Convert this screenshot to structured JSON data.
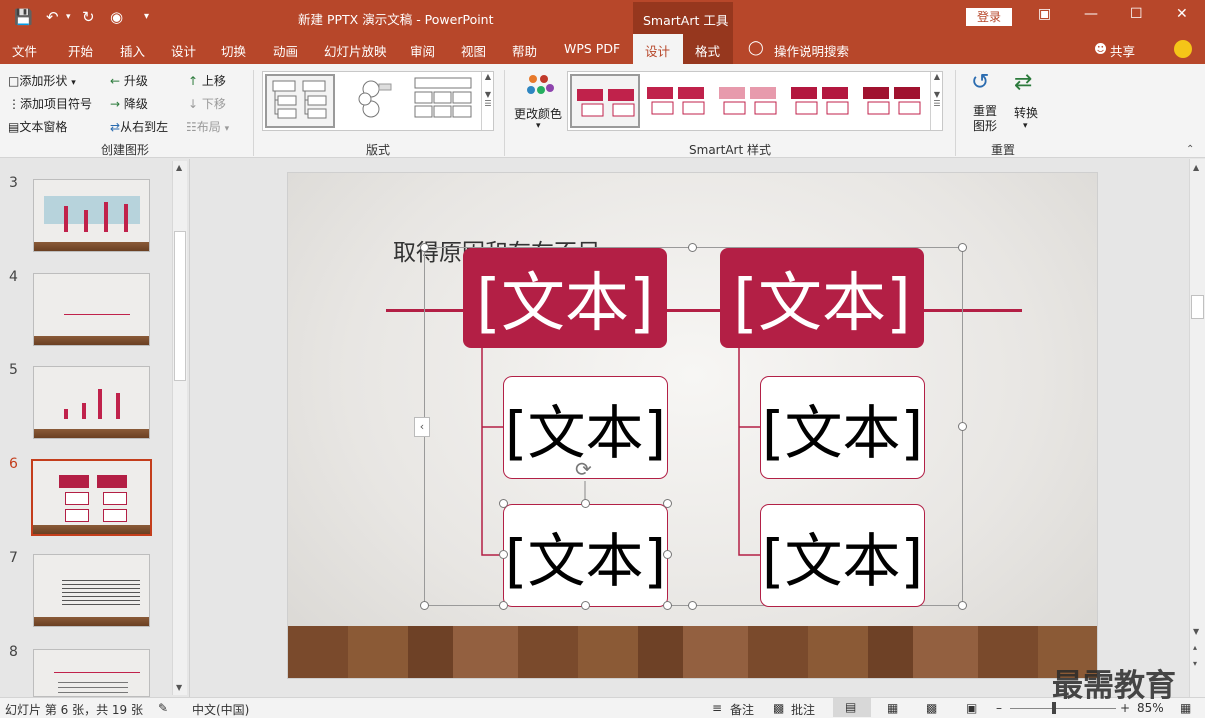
{
  "window": {
    "doc_title": "新建 PPTX 演示文稿 - PowerPoint",
    "contextual_tab": "SmartArt 工具",
    "login": "登录"
  },
  "tabs": [
    "文件",
    "开始",
    "插入",
    "设计",
    "切换",
    "动画",
    "幻灯片放映",
    "审阅",
    "视图",
    "帮助",
    "WPS PDF",
    "设计",
    "格式"
  ],
  "search_hint": "操作说明搜索",
  "share": "共享",
  "ribbon": {
    "create": {
      "add_shape": "添加形状",
      "add_bullet": "添加项目符号",
      "text_pane": "文本窗格",
      "promote": "升级",
      "demote": "降级",
      "rtl": "从右到左",
      "move_up": "上移",
      "move_down": "下移",
      "layout": "布局",
      "label": "创建图形"
    },
    "layouts_label": "版式",
    "change_colors": "更改颜色",
    "styles_label": "SmartArt 样式",
    "reset": {
      "reset_graphic": "重置图形",
      "convert": "转换",
      "label": "重置"
    }
  },
  "slides": [
    {
      "num": "3"
    },
    {
      "num": "4"
    },
    {
      "num": "5"
    },
    {
      "num": "6"
    },
    {
      "num": "7"
    },
    {
      "num": "8"
    }
  ],
  "slide": {
    "title": "取得原因和存在不足",
    "parent1": "[文本]",
    "parent2": "[文本]",
    "child1": "[文本]",
    "child2": "[文本]",
    "child3": "[文本]",
    "child4": "[文本]"
  },
  "status": {
    "slide_info": "幻灯片 第 6 张，共 19 张",
    "language": "中文(中国)",
    "notes": "备注",
    "comments": "批注",
    "zoom": "85%"
  },
  "watermark": "最需教育",
  "colors": {
    "accent": "#b7472a",
    "smartart": "#b31f45",
    "context_tab": "#96371e"
  }
}
